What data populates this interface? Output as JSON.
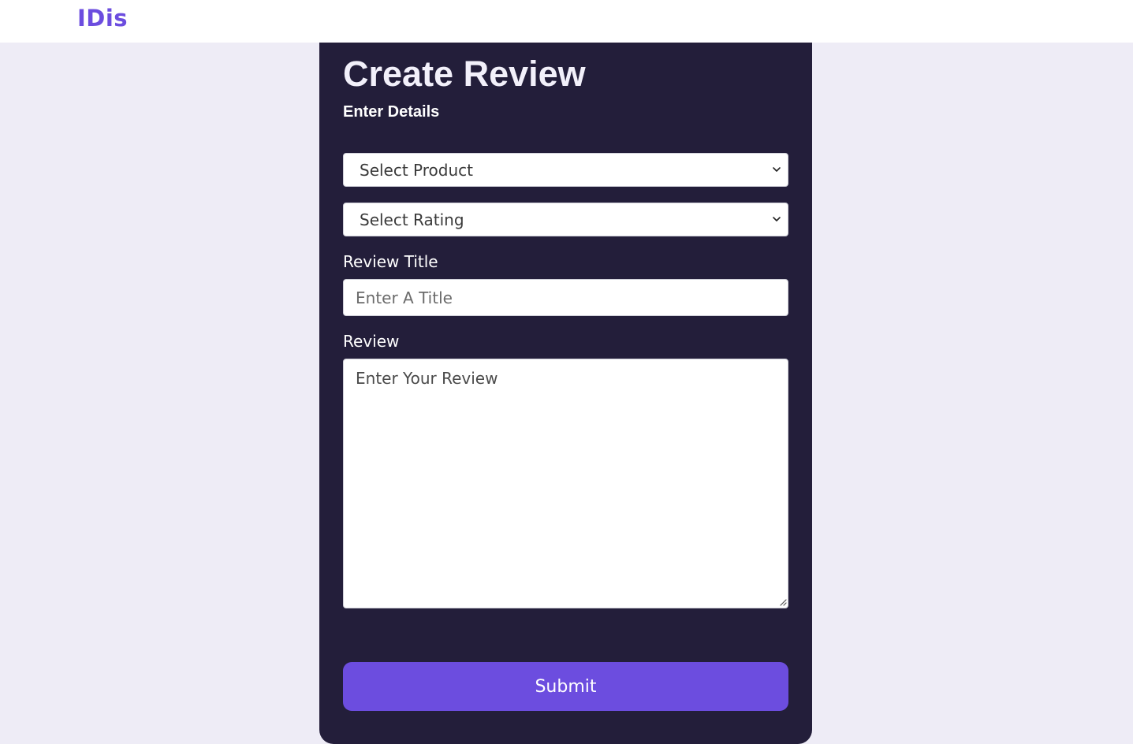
{
  "navbar": {
    "brand": "IDis"
  },
  "form": {
    "title": "Create Review",
    "subtitle": "Enter Details",
    "product_select": {
      "selected": "Select Product"
    },
    "rating_select": {
      "selected": "Select Rating"
    },
    "review_title": {
      "label": "Review Title",
      "placeholder": "Enter A Title",
      "value": ""
    },
    "review": {
      "label": "Review",
      "placeholder": "Enter Your Review",
      "value": ""
    },
    "submit_label": "Submit"
  },
  "icons": {
    "select_arrow": "chevron-down-icon",
    "textarea_resize": "resize-grip-icon"
  },
  "colors": {
    "brand": "#6c4ddf",
    "card_background": "#231e3a",
    "page_background": "#eeecf6",
    "button": "#6c4ddf"
  }
}
